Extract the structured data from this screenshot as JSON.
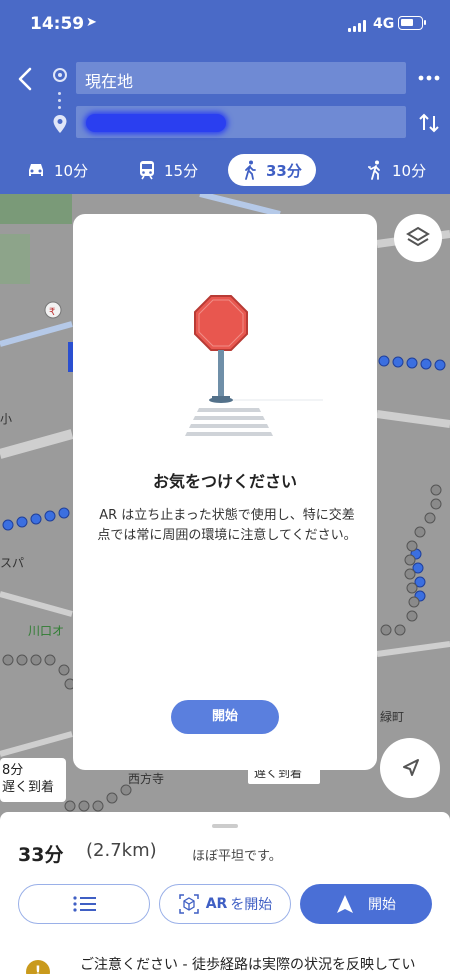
{
  "status_bar": {
    "time": "14:59",
    "network": "4G"
  },
  "route": {
    "origin_value": "現在地",
    "destination_value": ""
  },
  "travel_modes": [
    {
      "icon": "car-icon",
      "label": "10分"
    },
    {
      "icon": "transit-icon",
      "label": "15分"
    },
    {
      "icon": "walk-icon",
      "label": "33分",
      "active": true
    },
    {
      "icon": "rideshare-icon",
      "label": "10分"
    }
  ],
  "map": {
    "labels": [
      "川口オ",
      "スパ",
      "西方寺",
      "緑町",
      "小"
    ],
    "left_card": {
      "line1": "8分",
      "line2": "遅く到着"
    },
    "center_card": "遅く到着"
  },
  "dialog": {
    "title": "お気をつけください",
    "body": "AR は立ち止まった状態で使用し、特に交差点では常に周囲の環境に注意してください。",
    "start_button": "開始"
  },
  "sheet": {
    "eta": "33分",
    "distance": "(2.7km)",
    "terrain": "ほぼ平坦です。",
    "ar_button_prefix": "AR",
    "ar_button_suffix": "を開始",
    "start_button": "開始",
    "notice": "ご注意ください - 徒歩経路は実際の状況を反映してい"
  },
  "colors": {
    "header_blue": "#4a6ac7",
    "route_blue": "#3b6fe0",
    "route_gray": "#8a8a8a",
    "accent": "#4a6fd6"
  }
}
